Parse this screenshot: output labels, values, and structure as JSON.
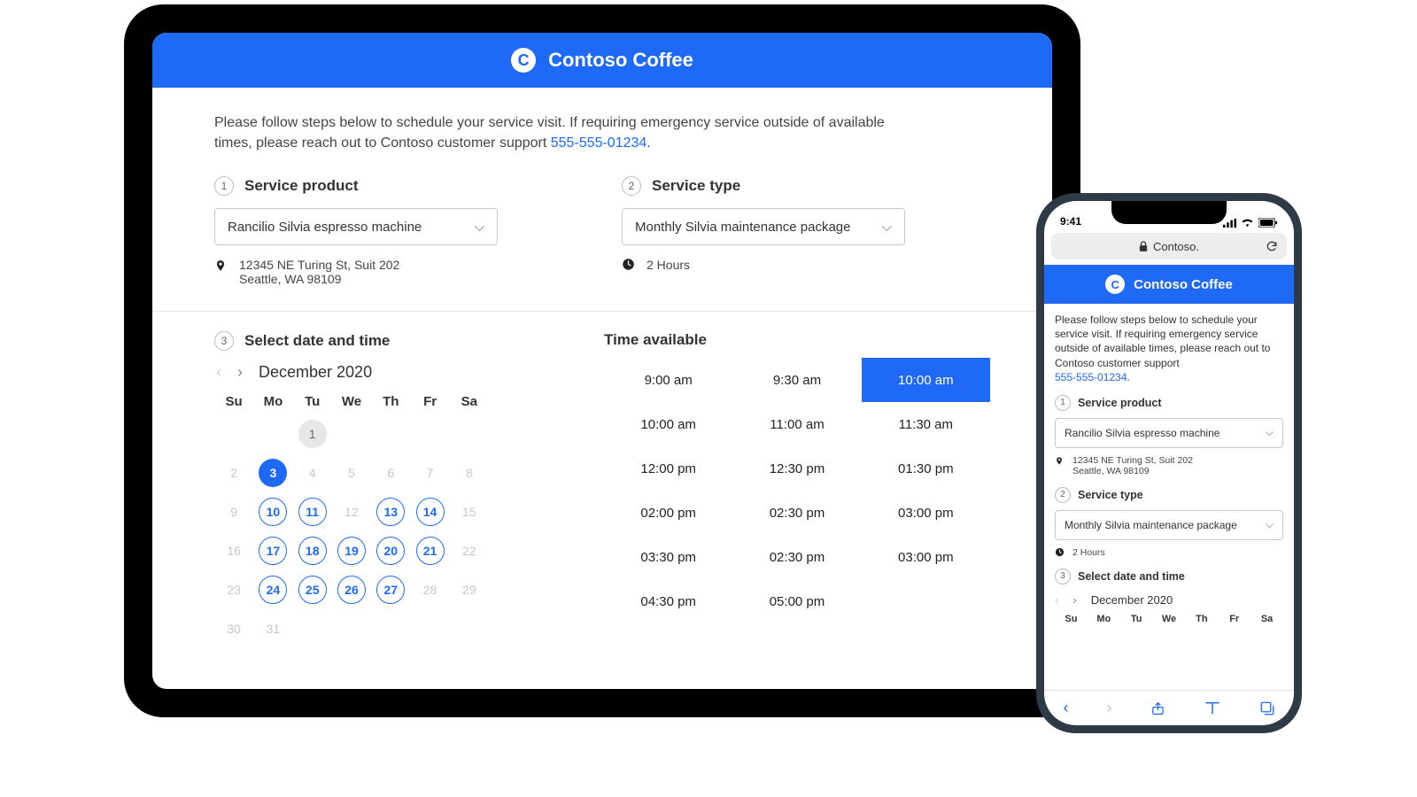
{
  "brand": "Contoso Coffee",
  "intro_text": "Please follow steps below to schedule your service visit. If requiring emergency service outside of available times, please reach out to Contoso customer support ",
  "support_phone": "555-555-01234",
  "steps": {
    "product_label": "Service product",
    "type_label": "Service type",
    "datetime_label": "Select date and time"
  },
  "product_select": "Rancilio Silvia espresso machine",
  "type_select": "Monthly Silvia maintenance package",
  "address_line1": "12345 NE Turing St, Suit 202",
  "address_line2": "Seattle, WA 98109",
  "duration": "2 Hours",
  "calendar": {
    "month_label": "December 2020",
    "dow": [
      "Su",
      "Mo",
      "Tu",
      "We",
      "Th",
      "Fr",
      "Sa"
    ],
    "cells": [
      {
        "n": "",
        "state": ""
      },
      {
        "n": "",
        "state": ""
      },
      {
        "n": "1",
        "state": "prev"
      },
      {
        "n": "",
        "state": ""
      },
      {
        "n": "",
        "state": ""
      },
      {
        "n": "",
        "state": ""
      },
      {
        "n": "",
        "state": ""
      },
      {
        "n": "2",
        "state": "muted"
      },
      {
        "n": "3",
        "state": "selected"
      },
      {
        "n": "4",
        "state": "muted"
      },
      {
        "n": "5",
        "state": "muted"
      },
      {
        "n": "6",
        "state": "muted"
      },
      {
        "n": "7",
        "state": "muted"
      },
      {
        "n": "8",
        "state": "muted"
      },
      {
        "n": "9",
        "state": "muted"
      },
      {
        "n": "10",
        "state": "avail"
      },
      {
        "n": "11",
        "state": "avail"
      },
      {
        "n": "12",
        "state": "muted"
      },
      {
        "n": "13",
        "state": "avail"
      },
      {
        "n": "14",
        "state": "avail"
      },
      {
        "n": "15",
        "state": "muted"
      },
      {
        "n": "16",
        "state": "muted"
      },
      {
        "n": "17",
        "state": "avail"
      },
      {
        "n": "18",
        "state": "avail"
      },
      {
        "n": "19",
        "state": "avail"
      },
      {
        "n": "20",
        "state": "avail"
      },
      {
        "n": "21",
        "state": "avail"
      },
      {
        "n": "22",
        "state": "muted"
      },
      {
        "n": "23",
        "state": "muted"
      },
      {
        "n": "24",
        "state": "avail"
      },
      {
        "n": "25",
        "state": "avail"
      },
      {
        "n": "26",
        "state": "avail"
      },
      {
        "n": "27",
        "state": "avail"
      },
      {
        "n": "28",
        "state": "muted"
      },
      {
        "n": "29",
        "state": "muted"
      },
      {
        "n": "30",
        "state": "muted"
      },
      {
        "n": "31",
        "state": "muted"
      },
      {
        "n": "",
        "state": ""
      },
      {
        "n": "",
        "state": ""
      },
      {
        "n": "",
        "state": ""
      },
      {
        "n": "",
        "state": ""
      },
      {
        "n": "",
        "state": ""
      }
    ]
  },
  "times_heading": "Time available",
  "time_slots": [
    {
      "t": "9:00 am",
      "sel": false
    },
    {
      "t": "9:30 am",
      "sel": false
    },
    {
      "t": "10:00 am",
      "sel": true
    },
    {
      "t": "10:00 am",
      "sel": false
    },
    {
      "t": "11:00 am",
      "sel": false
    },
    {
      "t": "11:30 am",
      "sel": false
    },
    {
      "t": "12:00 pm",
      "sel": false
    },
    {
      "t": "12:30 pm",
      "sel": false
    },
    {
      "t": "01:30 pm",
      "sel": false
    },
    {
      "t": "02:00 pm",
      "sel": false
    },
    {
      "t": "02:30 pm",
      "sel": false
    },
    {
      "t": "03:00 pm",
      "sel": false
    },
    {
      "t": "03:30 pm",
      "sel": false
    },
    {
      "t": "02:30 pm",
      "sel": false
    },
    {
      "t": "03:00 pm",
      "sel": false
    },
    {
      "t": "04:30 pm",
      "sel": false
    },
    {
      "t": "05:00 pm",
      "sel": false
    },
    {
      "t": "",
      "sel": false
    }
  ],
  "mobile": {
    "status_time": "9:41",
    "url_host": "Contoso."
  }
}
